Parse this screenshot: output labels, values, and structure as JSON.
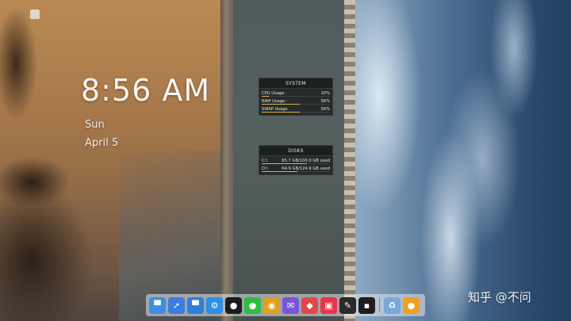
{
  "clock": {
    "time": "8:56 AM",
    "day": "Sun",
    "date": "April 5"
  },
  "system_widget": {
    "title": "SYSTEM",
    "rows": [
      {
        "label": "CPU Usage :",
        "value": "10%",
        "fraction": 0.1
      },
      {
        "label": "RAM Usage :",
        "value": "56%",
        "fraction": 0.56
      },
      {
        "label": "SWAP Usage",
        "value": "56%",
        "fraction": 0.56
      }
    ]
  },
  "disks_widget": {
    "title": "DISKS",
    "rows": [
      {
        "label": "C:\\",
        "value": "65.7 GB/100.0 GB used",
        "fraction": 0.657
      },
      {
        "label": "D:\\",
        "value": "64.9 GB/124.9 GB used",
        "fraction": 0.52
      }
    ]
  },
  "dock": {
    "items": [
      {
        "name": "file-manager-icon",
        "glyph": "▀",
        "color": "#3d8fe0"
      },
      {
        "name": "launcher-rocket-icon",
        "glyph": "➚",
        "color": "#3b7de0"
      },
      {
        "name": "folder-icon",
        "glyph": "▀",
        "color": "#2f7fd8"
      },
      {
        "name": "settings-gear-icon",
        "glyph": "⚙",
        "color": "#2a8fe8"
      },
      {
        "name": "qq-penguin-icon",
        "glyph": "●",
        "color": "#1b1b1b"
      },
      {
        "name": "wechat-icon",
        "glyph": "●",
        "color": "#2dbf3c"
      },
      {
        "name": "chrome-icon",
        "glyph": "◉",
        "color": "#e0a020"
      },
      {
        "name": "mail-icon",
        "glyph": "✉",
        "color": "#7a55d8"
      },
      {
        "name": "app-store-icon",
        "glyph": "◆",
        "color": "#e04848"
      },
      {
        "name": "photo-viewer-icon",
        "glyph": "▣",
        "color": "#e8334a"
      },
      {
        "name": "text-editor-icon",
        "glyph": "✎",
        "color": "#2b2b2b"
      },
      {
        "name": "terminal-icon",
        "glyph": "▪",
        "color": "#1e1e1e"
      },
      {
        "name": "recycle-icon",
        "glyph": "♻",
        "color": "#7aa8d8"
      },
      {
        "name": "duck-icon",
        "glyph": "●",
        "color": "#f0a020"
      }
    ]
  },
  "watermark": "知乎 @不问"
}
